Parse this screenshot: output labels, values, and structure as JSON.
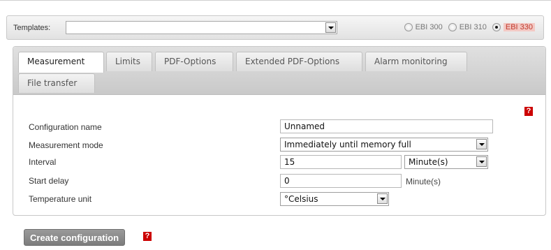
{
  "templates": {
    "label": "Templates:",
    "selected": "",
    "radios": [
      {
        "label": "EBI 300",
        "checked": false
      },
      {
        "label": "EBI 310",
        "checked": false
      },
      {
        "label": "EBI 330",
        "checked": true
      }
    ]
  },
  "tabs": [
    {
      "label": "Measurement",
      "active": true
    },
    {
      "label": "Limits",
      "active": false
    },
    {
      "label": "PDF-Options",
      "active": false
    },
    {
      "label": "Extended PDF-Options",
      "active": false
    },
    {
      "label": "Alarm monitoring",
      "active": false
    },
    {
      "label": "File transfer",
      "active": false
    }
  ],
  "help_icon": "?",
  "form": {
    "configuration_name": {
      "label": "Configuration name",
      "value": "Unnamed"
    },
    "measurement_mode": {
      "label": "Measurement mode",
      "value": "Immediately until memory full"
    },
    "interval": {
      "label": "Interval",
      "value": "15",
      "unit": "Minute(s)"
    },
    "start_delay": {
      "label": "Start delay",
      "value": "0",
      "unit": "Minute(s)"
    },
    "temperature_unit": {
      "label": "Temperature unit",
      "value": "°Celsius"
    }
  },
  "create_button": "Create configuration",
  "colors": {
    "help": "#cc0000",
    "active_radio": "#c0392b"
  }
}
